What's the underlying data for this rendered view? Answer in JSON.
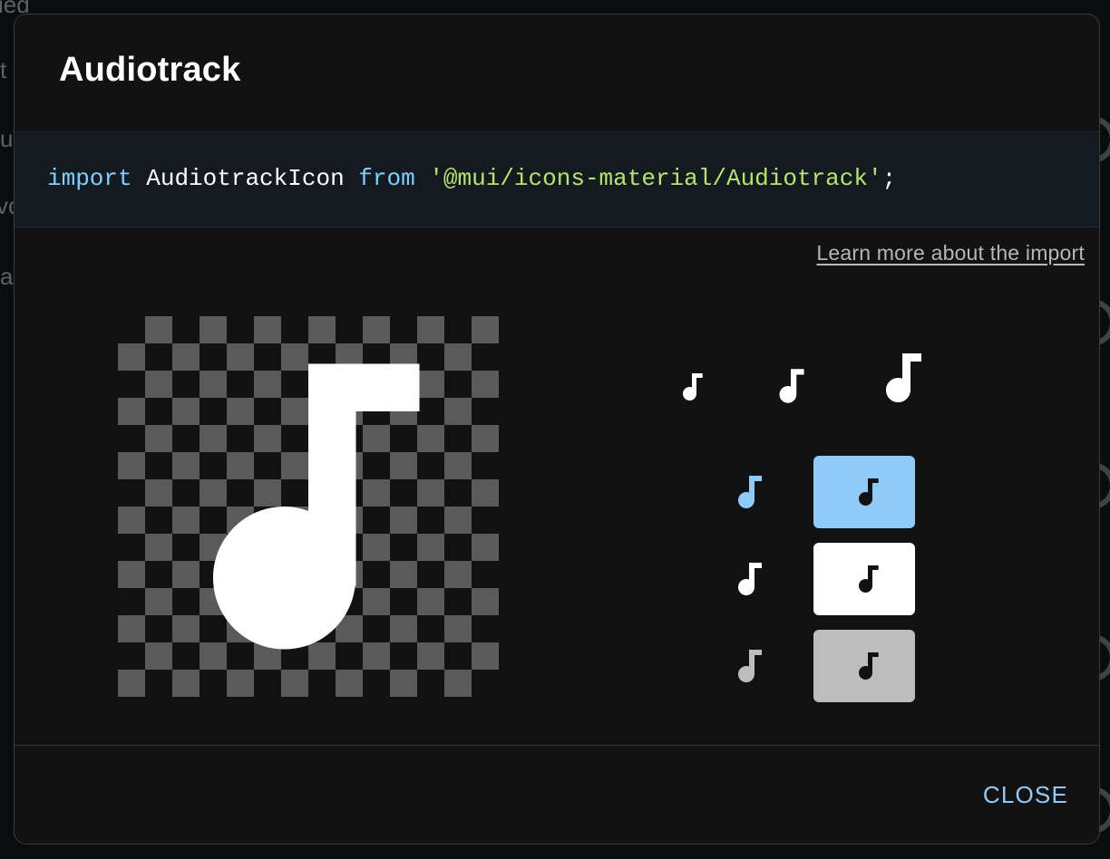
{
  "background": {
    "fragments": [
      "ied",
      "t",
      "u",
      "vo",
      "a"
    ]
  },
  "dialog": {
    "title": "Audiotrack",
    "import_code": {
      "keyword_import": "import",
      "identifier": "AudiotrackIcon",
      "keyword_from": "from",
      "module_path": "'@mui/icons-material/Audiotrack'",
      "terminator": ";"
    },
    "learn_more_link": "Learn more about the import",
    "preview": {
      "icon": "audiotrack-icon",
      "checkerboard_colors": [
        "#121212",
        "#5a5a5a"
      ]
    },
    "size_variants": [
      "small",
      "medium",
      "large"
    ],
    "color_rows": [
      {
        "name": "primary",
        "icon_color": "#90caf9",
        "swatch_bg": "#90caf9"
      },
      {
        "name": "white",
        "icon_color": "#ffffff",
        "swatch_bg": "#ffffff"
      },
      {
        "name": "grey",
        "icon_color": "#bdbdbd",
        "swatch_bg": "#bdbdbd"
      }
    ],
    "close_label": "CLOSE",
    "colors": {
      "accent": "#90caf9",
      "surface": "#121212",
      "code_bg": "#131a20",
      "string": "#b9e36a",
      "keyword": "#7fd0ff"
    }
  }
}
